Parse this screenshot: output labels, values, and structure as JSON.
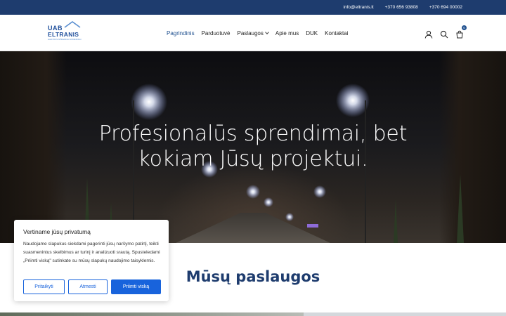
{
  "topbar": {
    "email": "info@eltranis.lt",
    "phone1": "+370 656 93808",
    "phone2": "+370 694 00002"
  },
  "logo": {
    "line1": "UAB",
    "line2": "ELTRANIS",
    "sub": "ELEKTROS INŽINERINIAI SPRENDIMAI"
  },
  "nav": {
    "items": [
      {
        "label": "Pagrindinis",
        "active": true
      },
      {
        "label": "Parduotuvė"
      },
      {
        "label": "Paslaugos",
        "dropdown": true
      },
      {
        "label": "Apie mus"
      },
      {
        "label": "DUK"
      },
      {
        "label": "Kontaktai"
      }
    ]
  },
  "header_icons": {
    "user": "user-icon",
    "search": "search-icon",
    "cart": "cart-icon",
    "cart_count": "0"
  },
  "hero": {
    "title_line1": "Profesionalūs sprendimai, bet",
    "title_line2": "kokiam Jūsų projektui."
  },
  "services": {
    "title": "Mūsų paslaugos"
  },
  "cookie": {
    "title": "Vertiname jūsų privatumą",
    "text": "Naudojame slapukus siekdami pagerinti jūsų naršymo patirtį, teikti suasmenintus skelbimus ar turinį ir analizuoti srautą. Spusteledami „Priimti viską\" sutinkate su mūsų slapukų naudojimo taisyklemis.",
    "customize": "Pritaikyti",
    "reject": "Atmesti",
    "accept": "Priimti viską"
  },
  "colors": {
    "brand": "#1e3c6e",
    "accent": "#1863dc"
  }
}
